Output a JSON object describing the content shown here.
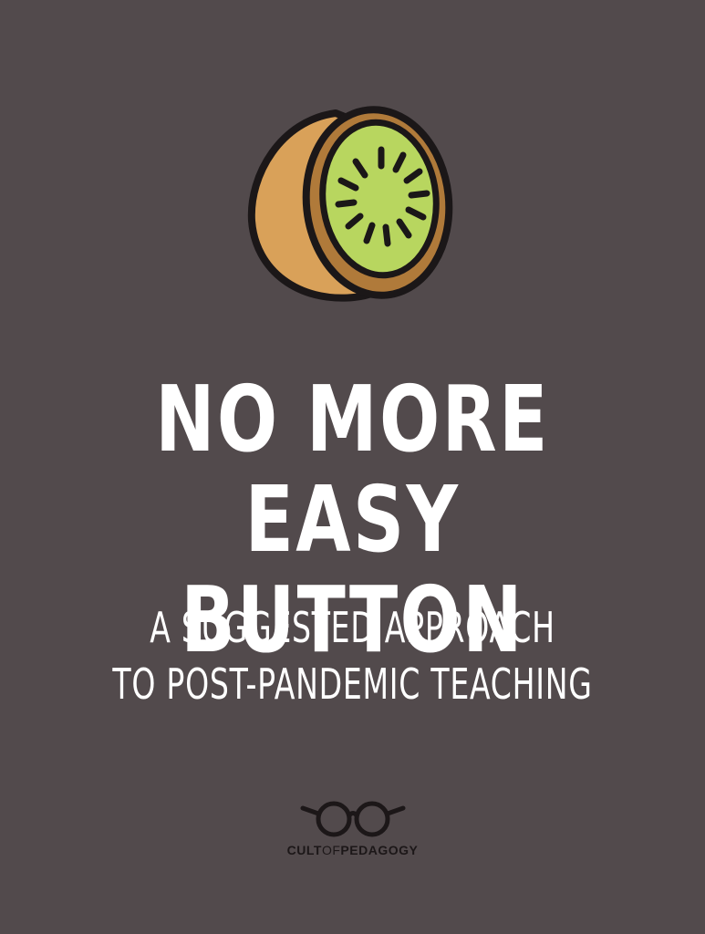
{
  "title_lines": [
    "NO MORE",
    "EASY BUTTON"
  ],
  "subtitle_lines": [
    "A SUGGESTED APPROACH",
    "TO POST-PANDEMIC TEACHING"
  ],
  "logo": {
    "word_1": "CULT",
    "word_2": "OF",
    "word_3": "PEDAGOGY"
  },
  "icons": {
    "hero": "kiwi-icon",
    "logo": "glasses-icon"
  },
  "colors": {
    "background": "#524a4c",
    "text": "#ffffff",
    "kiwi_skin": "#d9a159",
    "kiwi_rim": "#b07a3a",
    "kiwi_flesh": "#b8d65f",
    "logo": "#1c1718"
  }
}
